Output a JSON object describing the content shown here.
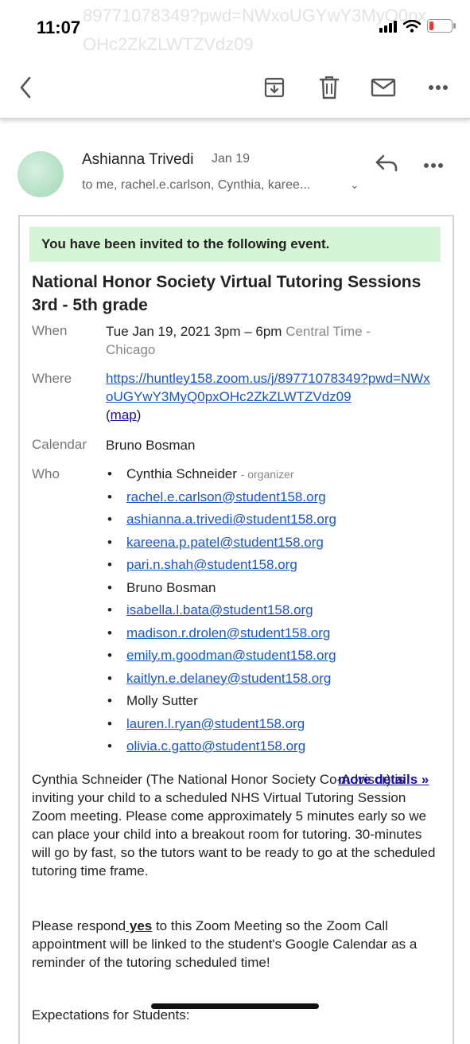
{
  "status": {
    "time": "11:07",
    "ghost_text": "89771078349?pwd=NWxoUGYwY3MyQ0pxOHc2ZkZLWTZVdz09"
  },
  "toolbar": {
    "back_icon": "chevron-left-icon",
    "archive_icon": "archive-icon",
    "delete_icon": "trash-icon",
    "mark_unread_icon": "mail-icon",
    "more_icon": "more-horizontal-icon"
  },
  "message": {
    "sender": "Ashianna Trivedi",
    "date": "Jan 19",
    "recipients": "to me, rachel.e.carlson, Cynthia, karee..."
  },
  "invite": {
    "banner": "You have been invited to the following event.",
    "title": "National Honor Society Virtual Tutoring Sessions 3rd - 5th grade",
    "when_label": "When",
    "when_value": "Tue Jan 19, 2021 3pm – 6pm",
    "when_tz": "Central Time - Chicago",
    "where_label": "Where",
    "where_link": "https://huntley158.zoom.us/j/89771078349?pwd=NWxoUGYwY3MyQ0pxOHc2ZkZLWTZVdz09",
    "map_label": "map",
    "calendar_label": "Calendar",
    "calendar_value": "Bruno Bosman",
    "who_label": "Who",
    "organizer_tag": "- organizer",
    "guests": [
      {
        "name": "Cynthia Schneider",
        "link": false
      },
      {
        "name": "rachel.e.carlson@student158.org",
        "link": true
      },
      {
        "name": "ashianna.a.trivedi@student158.org",
        "link": true
      },
      {
        "name": "kareena.p.patel@student158.org",
        "link": true
      },
      {
        "name": "pari.n.shah@student158.org",
        "link": true
      },
      {
        "name": "Bruno Bosman",
        "link": false
      },
      {
        "name": "isabella.l.bata@student158.org",
        "link": true
      },
      {
        "name": "madison.r.drolen@student158.org",
        "link": true
      },
      {
        "name": "emily.m.goodman@student158.org",
        "link": true
      },
      {
        "name": "kaitlyn.e.delaney@student158.org",
        "link": true
      },
      {
        "name": "Molly Sutter",
        "link": false
      },
      {
        "name": "lauren.l.ryan@student158.org",
        "link": true
      },
      {
        "name": "olivia.c.gatto@student158.org",
        "link": true
      }
    ],
    "more_details": "more details »",
    "description": "Cynthia Schneider (The National Honor Society Co-Advisor) is inviting your child to a scheduled NHS Virtual Tutoring Session Zoom meeting.   Please come approximately 5 minutes early so we can place your child into a breakout room for  tutoring.  30-minutes will go by fast, so the tutors want to be ready to go at the scheduled tutoring time frame.",
    "respond_pre": "Please respond",
    "respond_yes": " yes",
    "respond_post": " to this Zoom Meeting so the Zoom Call appointment will be linked to the student's Google Calendar as a reminder of the tutoring scheduled time!",
    "expectations": "Expectations for Students:"
  }
}
